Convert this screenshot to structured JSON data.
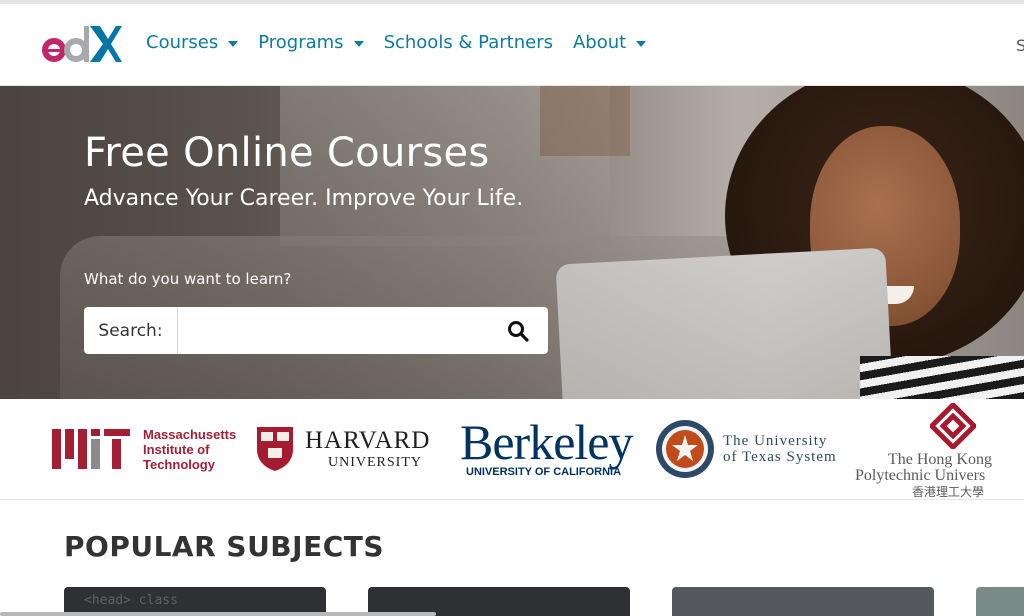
{
  "header": {
    "logo_text": "edX",
    "nav": [
      {
        "label": "Courses",
        "has_dropdown": true
      },
      {
        "label": "Programs",
        "has_dropdown": true
      },
      {
        "label": "Schools & Partners",
        "has_dropdown": false
      },
      {
        "label": "About",
        "has_dropdown": true
      }
    ],
    "right_edge_text": "S"
  },
  "hero": {
    "title": "Free Online Courses",
    "subtitle": "Advance Your Career. Improve Your Life.",
    "question": "What do you want to learn?",
    "search": {
      "label": "Search:",
      "value": "",
      "icon": "search-icon"
    }
  },
  "partners": {
    "mit": {
      "text_lines": [
        "Massachusetts",
        "Institute of",
        "Technology"
      ],
      "color": "#a31f34"
    },
    "harvard": {
      "name": "HARVARD",
      "sub": "UNIVERSITY",
      "shield_text": [
        "VE RI",
        "TAS"
      ]
    },
    "berkeley": {
      "name": "Berkeley",
      "sub": "UNIVERSITY OF CALIFORNIA",
      "color": "#003262"
    },
    "ut": {
      "line1": "The University",
      "line2": "of Texas System"
    },
    "hk": {
      "line1": "The Hong Kong",
      "line2": "Polytechnic Univers",
      "line3": "香港理工大學"
    }
  },
  "popular": {
    "title": "POPULAR SUBJECTS",
    "cards": [
      {
        "snippet": "<head>      class"
      },
      {
        "snippet": ""
      },
      {
        "snippet": ""
      },
      {
        "snippet": ""
      }
    ]
  },
  "colors": {
    "link": "#0d7aa5",
    "brand_pink": "#c1266b",
    "brand_blue": "#0076a8"
  }
}
